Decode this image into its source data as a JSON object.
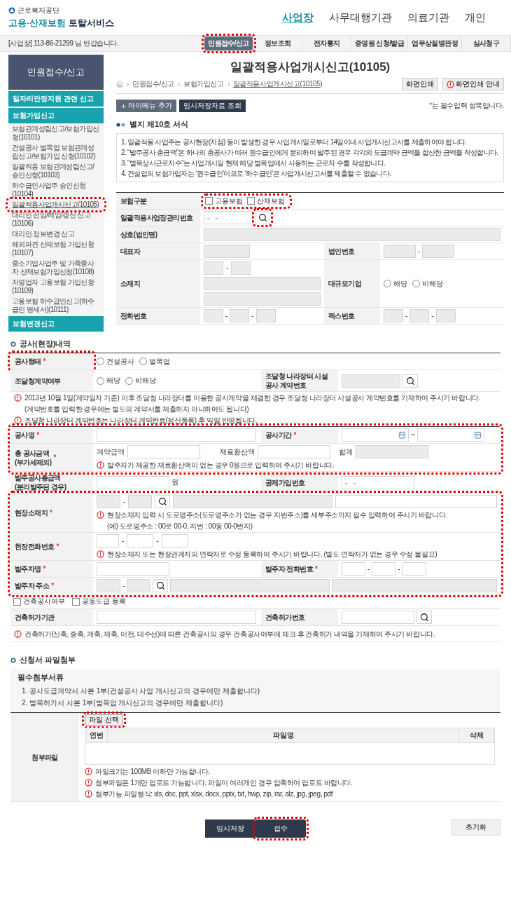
{
  "required_mark": "*",
  "separator": "-",
  "header": {
    "org": "근로복지공단",
    "title": "고용·산재보험",
    "subtitle": "토탈서비스",
    "nav": [
      {
        "label": "사업장",
        "selected": true
      },
      {
        "label": "사무대행기관",
        "selected": false
      },
      {
        "label": "의료기관",
        "selected": false
      },
      {
        "label": "개인",
        "selected": false
      }
    ]
  },
  "welcome": "[사업장] 113-86-21299 님 반갑습니다.",
  "menu": [
    {
      "label": "민원접수/신고",
      "selected": true,
      "highlighted": true
    },
    {
      "label": "정보조회",
      "selected": false,
      "highlighted": false
    },
    {
      "label": "전자통지",
      "selected": false,
      "highlighted": false
    },
    {
      "label": "증명원 신청/발급",
      "selected": false,
      "highlighted": false
    },
    {
      "label": "업무상질병판정",
      "selected": false,
      "highlighted": false
    },
    {
      "label": "심사청구",
      "selected": false,
      "highlighted": false
    }
  ],
  "sidebar": {
    "title": "민원접수/신고",
    "groups": [
      {
        "label": "일자리안정지원 관련 신고"
      },
      {
        "label": "보험가입신고",
        "items": [
          {
            "label": "보험관계성립신고/보험가입신청(10101)",
            "selected": false,
            "highlighted": false
          },
          {
            "label": "건설공사 벌목업 보험관계성립신고/보험가입 신청(10102)",
            "selected": false,
            "highlighted": false
          },
          {
            "label": "일괄적용 보험관계성립신고/승인신청(10103)",
            "selected": false,
            "highlighted": false
          },
          {
            "label": "하수급인사업주 승인신청(10104)",
            "selected": false,
            "highlighted": false
          },
          {
            "label": "일괄적용사업개시신고(10105)",
            "selected": true,
            "highlighted": true
          },
          {
            "label": "대리인 선임/해임/갱신 신고(10106)",
            "selected": false,
            "highlighted": false
          },
          {
            "label": "대리인 정보변경 신고",
            "selected": false,
            "highlighted": false
          },
          {
            "label": "해외파견 산재보험 가입신청(10107)",
            "selected": false,
            "highlighted": false
          },
          {
            "label": "중소기업사업주 및 가족종사자 산재보험가입신청(10108)",
            "selected": false,
            "highlighted": false
          },
          {
            "label": "자영업자 고용보험 가입신청(10109)",
            "selected": false,
            "highlighted": false
          },
          {
            "label": "고용보험 하수급인신고(하수급인 명세서)(10111)",
            "selected": false,
            "highlighted": false
          }
        ]
      },
      {
        "label": "보험변경신고"
      }
    ]
  },
  "page": {
    "title": "일괄적용사업개시신고(10105)",
    "breadcrumb": [
      "민원접수/신고",
      "보험가입신고",
      "일괄적용사업개시신고(10105)"
    ],
    "print_buttons": [
      "화면인쇄",
      "화면인쇄 안내"
    ],
    "add_menu": "마이메뉴 추가",
    "saved": "임시저장자료 조회",
    "required_note": "는 필수입력 항목입니다."
  },
  "form": {
    "title": "별지 제10호 서식",
    "notes": [
      "1. 일괄적용 사업주는 공사현장(지점) 등이 발생한 경우 사업개시일로부터 14일이내 사업개시신고서를 제출하여야 합니다.",
      "2. “발주공사 총금액”은 하나의 총공사가 여러 원수급인에게 분리하여 발주된 경우 각각의 도급계약 금액을 합산한 금액을 작성합니다.",
      "3. “벌목상시근로자수”는 사업개시일 현재 해당 벌목업에서 사용하는 근로자 수를 작성합니다.",
      "4. 건설업의 보험가입자는 ‘원수급인’이므로 ‘하수급인’은 사업개시신고서를 제출할 수 없습니다."
    ]
  },
  "employer": {
    "insurance": {
      "label": "보험구분",
      "highlighted": true,
      "options": [
        {
          "label": "고용보험",
          "checked": false
        },
        {
          "label": "산재보험",
          "checked": false
        }
      ]
    },
    "mgmt_no": {
      "label": "일괄적용사업장관리번호",
      "placeholder": "-   -",
      "search_highlighted": true
    },
    "company": "상호(법인명)",
    "ceo": "대표자",
    "corp_no": "법인번호",
    "address": "소재지",
    "large": {
      "label": "대규모기업",
      "options": [
        {
          "label": "해당",
          "selected": false
        },
        {
          "label": "비해당",
          "selected": false
        }
      ]
    },
    "phone": "전화번호",
    "fax": "팩스번호"
  },
  "work": {
    "title": "공사(현장)내역",
    "type": {
      "label": "공사형태",
      "required": true,
      "highlighted": true,
      "options": [
        {
          "label": "건설공사",
          "selected": false
        },
        {
          "label": "벌목업",
          "selected": false
        }
      ]
    },
    "procurement": {
      "label": "조달청계약여부",
      "options": [
        {
          "label": "해당",
          "selected": false
        },
        {
          "label": "비해당",
          "selected": false
        }
      ],
      "contract_label": "조달청 나라장터 시설\n공사 계약번호"
    },
    "notices": [
      {
        "text": "2013년 10월 1일(계약일자 기준) 이후 조달청 나라장터를 이용한 공사계약을 체결한 경우 조달청 나라장터 시설공사  계약번호를 기재하여 주시기 바랍니다.",
        "sub": "(계약번호를 입력한 경우에는 별도의 계약서를 제출하지 아니하여도 됩니다)"
      },
      {
        "text": "조달청 나라장터 계약번호는 나라장터 계약완료(정산등록) 후 익일 반영됩니다."
      }
    ],
    "contract_group": {
      "highlighted": true,
      "name": {
        "label": "공사명",
        "required": true
      },
      "period": {
        "label": "공사기간",
        "required": true
      },
      "tilde": "~",
      "amount": {
        "label": "총 공사금액\n(부가세제외)",
        "required": true,
        "contract": "계약금액",
        "material": "재료환산액",
        "total": "합계",
        "notice": "발주자가 제공한 재료환산액이 없는 경우 0원으로 입력하여 주시기 바랍니다."
      }
    },
    "order_total": {
      "label": "발주공사총금액\n(분리발주된 경우)",
      "unit": "원"
    },
    "deduction": {
      "label": "공제가입번호",
      "placeholder": "-   -"
    },
    "site_group": {
      "highlighted": true,
      "site_address": {
        "label": "현장소재지",
        "required": true,
        "notice": "현장소재지 입력 시 도로명주소(도로명주소가 없는 경우 지번주소)를 세부주소까지 필수 입력하여 주시기 바랍니다.",
        "example": "(예) 도로명주소 : 00로 00-0, 지번 : 00동 00-0번지)"
      },
      "site_phone": {
        "label": "현장전화번호",
        "required": true,
        "notice": "현장소재지 또는 현장관계자의 연락처로 수정 등록하여 주시기 바랍니다. (별도 연락처가 없는 경우 수정 불필요)"
      },
      "client_name": {
        "label": "발주자명",
        "required": true
      },
      "client_phone": {
        "label": "발주자 전화번호",
        "required": true
      },
      "client_address": {
        "label": "발주자 주소",
        "required": true
      }
    },
    "flags": [
      {
        "label": "건축공사여부",
        "checked": false
      },
      {
        "label": "공동도급 등록",
        "checked": false
      }
    ],
    "permit": {
      "agency": "건축허가기관",
      "number": "건축허가번호",
      "notice": "건축허가(신축, 증축, 개축, 재축, 이전, 대수선)에 따른 건축공사의 경우 건축공사여부에 체크 후 건축허가 내역을 기재하여 주시기 바랍니다."
    }
  },
  "attach": {
    "title": "신청서 파일첨부",
    "required_title": "필수첨부서류",
    "docs": [
      "1. 공사도급계약서 사본 1부(건설공사 사업 개시신고의 경우에만 제출합니다)",
      "2. 벌목허가서 사본 1부(벌목업 개시신고의 경우에만 제출합니다)"
    ],
    "label": "첨부파일",
    "choose": {
      "label": "파일 선택",
      "highlighted": true
    },
    "columns": [
      "연번",
      "파일명",
      "삭제"
    ],
    "notices": [
      "파일크기는 100MB 이하만 가능합니다.",
      "첨부파일은 1개만 업로드 가능합니다. 파일이 여러개인 경우 압축하여 업로드 바랍니다.",
      "첨부가능 파일형식: xls, doc, ppt, xlsx, docx, pptx, txt, hwp, zip, rar, alz, jpg, jpeg, pdf"
    ]
  },
  "footer": {
    "buttons": [
      {
        "label": "임시저장",
        "highlighted": false
      },
      {
        "label": "접수",
        "highlighted": true
      }
    ],
    "reset": "초기화"
  }
}
